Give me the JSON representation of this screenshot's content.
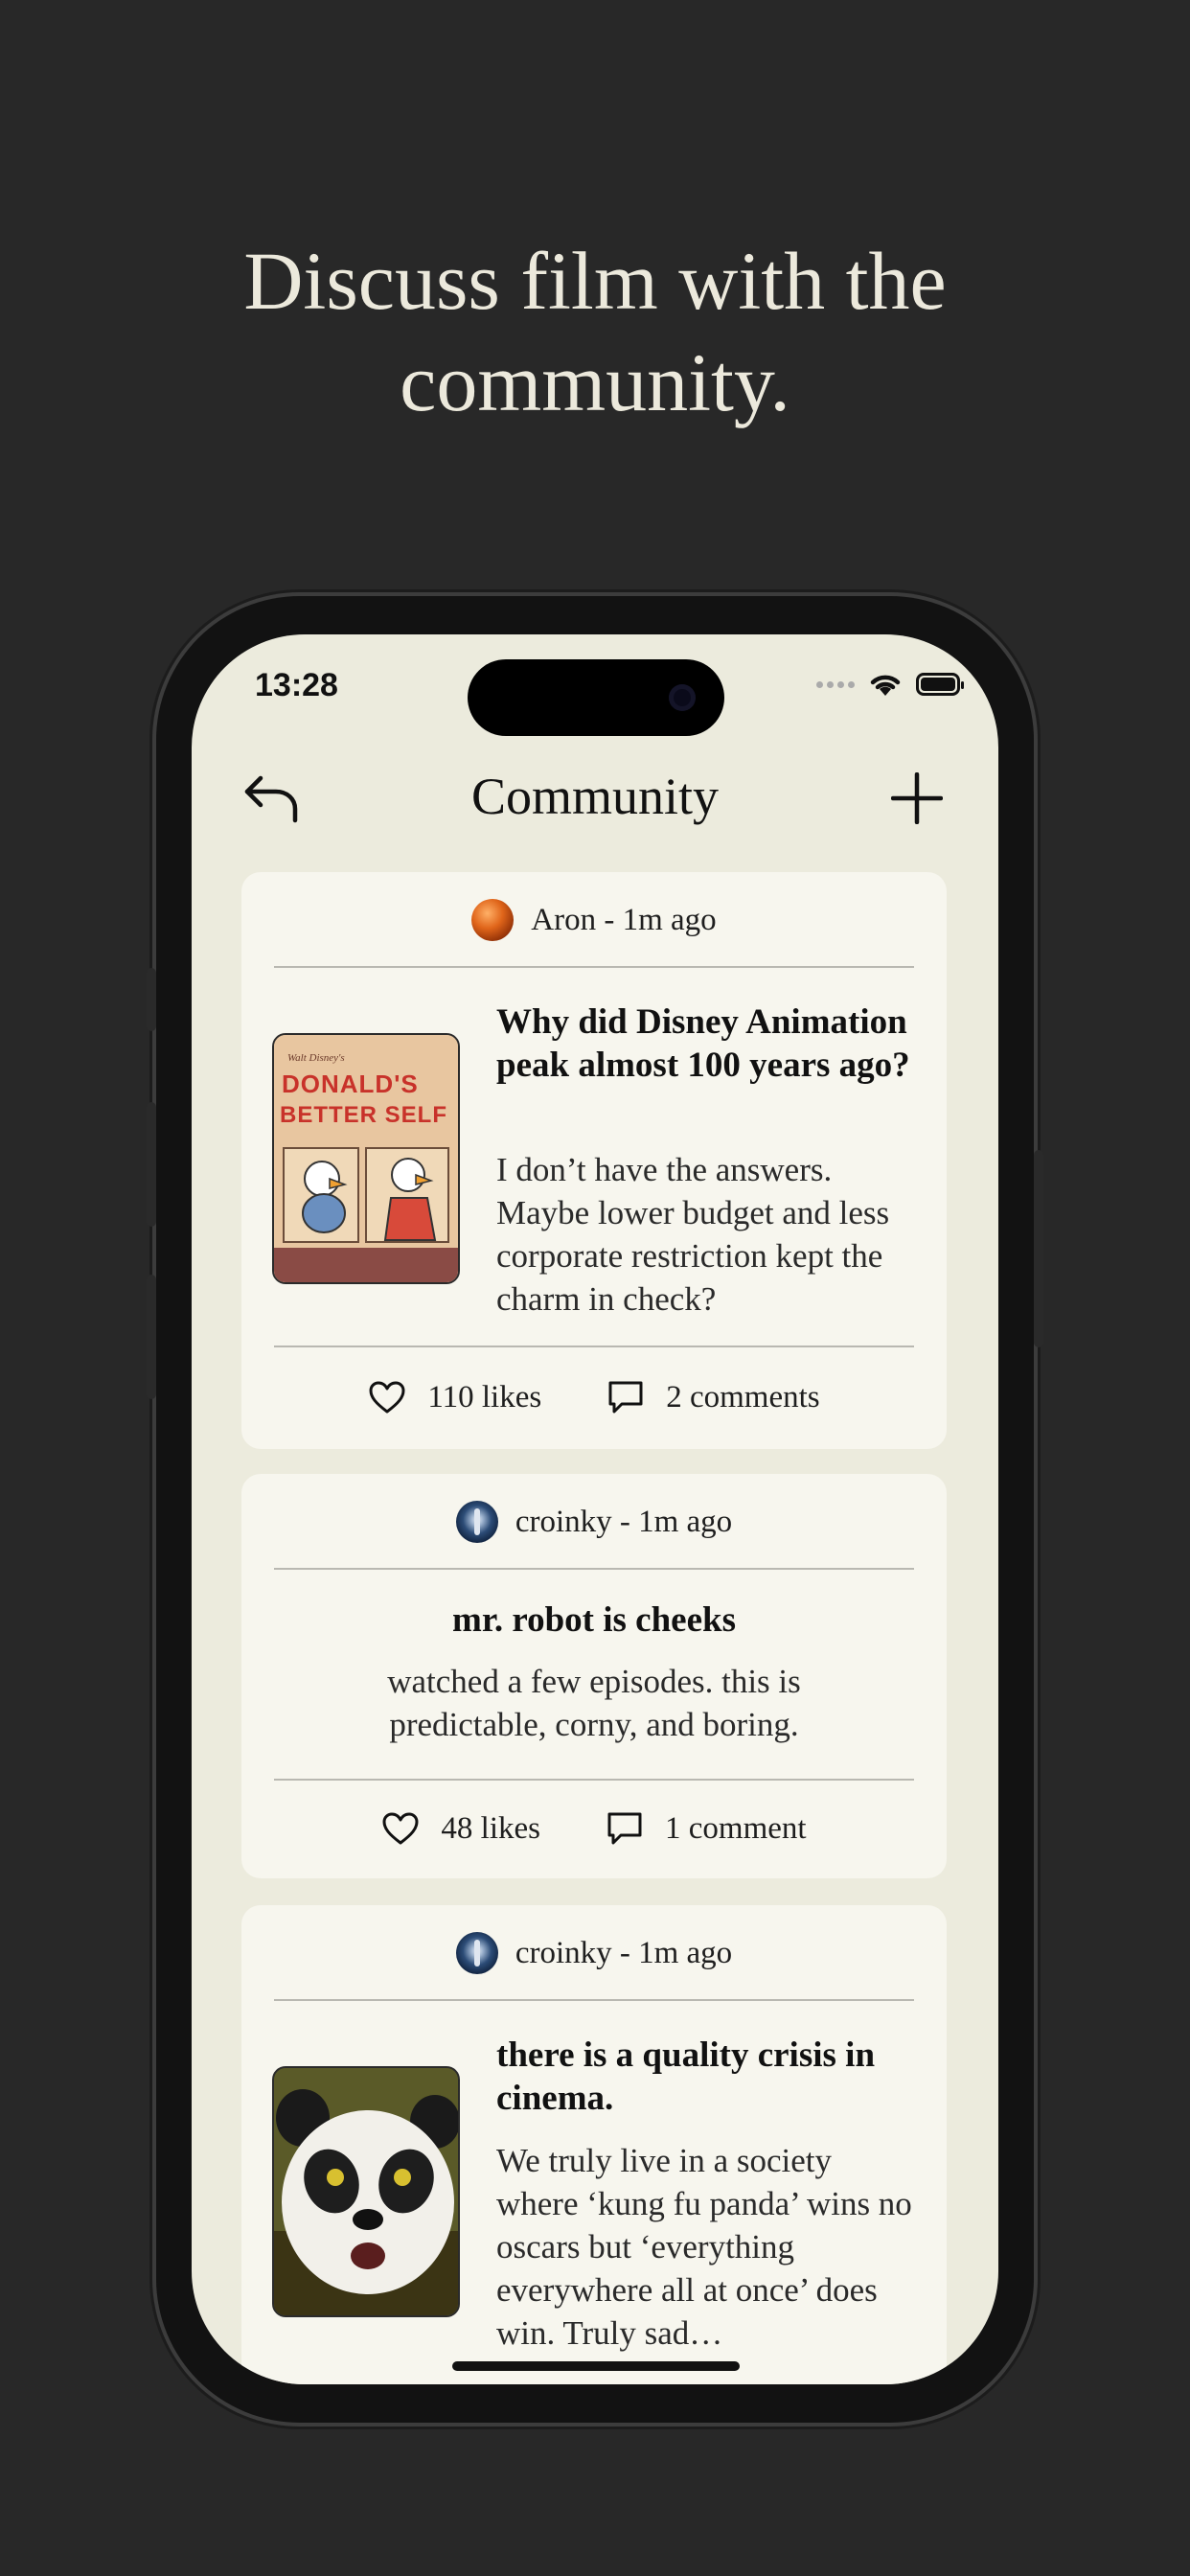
{
  "headline": {
    "line1": "Discuss film with the",
    "line2": "community."
  },
  "status_bar": {
    "time": "13:28"
  },
  "nav": {
    "title": "Community",
    "back_icon": "back-arrow-icon",
    "add_icon": "plus-icon"
  },
  "posts": [
    {
      "meta": "Aron - 1m ago",
      "avatar": "orange-sphere",
      "title": "Why did Disney Animation peak almost 100 years ago?",
      "body": "I don’t have the answers. Maybe lower budget and less corporate restriction kept the charm in check?",
      "thumbnail": "donald-duck-poster",
      "thumbnail_text": [
        "Walt Disney's",
        "DONALD'S",
        "BETTER SELF"
      ],
      "likes": "110 likes",
      "comments": "2 comments"
    },
    {
      "meta": "croinky - 1m ago",
      "avatar": "blue-figure",
      "title": "mr. robot is cheeks",
      "body": "watched a few episodes. this is predictable, corny, and boring.",
      "likes": "48 likes",
      "comments": "1 comment"
    },
    {
      "meta": "croinky - 1m ago",
      "avatar": "blue-figure",
      "title": "there is a quality crisis in cinema.",
      "body": "We truly live in a society where ‘kung fu panda’ wins no oscars but ‘everything everywhere all at once’ does win. Truly sad…",
      "thumbnail": "panda-image"
    }
  ],
  "colors": {
    "background": "#282828",
    "screen": "#ecebdd",
    "card": "#f7f6ee",
    "headline": "#ece9dc"
  }
}
